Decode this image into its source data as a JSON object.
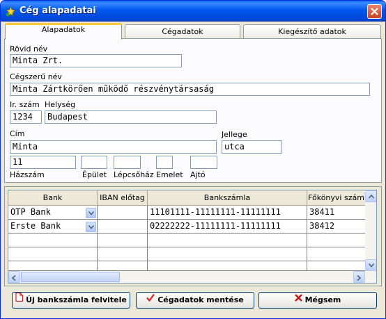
{
  "window": {
    "title": "Cég alapadatai"
  },
  "tabs": [
    {
      "label": "Alapadatok",
      "active": true
    },
    {
      "label": "Cégadatok",
      "active": false
    },
    {
      "label": "Kiegészítő adatok",
      "active": false
    }
  ],
  "form": {
    "short_name": {
      "label": "Rövid név",
      "value": "Minta Zrt."
    },
    "company_name": {
      "label": "Cégszerű név",
      "value": "Minta Zártkörően működő részvénytársaság"
    },
    "zip": {
      "label": "Ir. szám",
      "value": "1234"
    },
    "city": {
      "label": "Helység",
      "value": "Budapest"
    },
    "address": {
      "label": "Cím",
      "value": "Minta"
    },
    "street_type": {
      "label": "Jellege",
      "value": "utca"
    },
    "house_no": {
      "label": "Házszám",
      "value": "11"
    },
    "building": {
      "label": "Épület",
      "value": ""
    },
    "staircase": {
      "label": "Lépcsőház",
      "value": ""
    },
    "floor": {
      "label": "Emelet",
      "value": ""
    },
    "door": {
      "label": "Ajtó",
      "value": ""
    }
  },
  "grid": {
    "columns": [
      "Bank",
      "IBAN előtag",
      "Bankszámla",
      "Főkönyvi szám"
    ],
    "rows": [
      {
        "bank": "OTP Bank",
        "iban": "",
        "account": "11101111-11111111-11111111",
        "ledger": "38411"
      },
      {
        "bank": "Erste Bank",
        "iban": "",
        "account": "02222222-11111111-11111111",
        "ledger": "38412"
      }
    ]
  },
  "buttons": {
    "new_account": "Új bankszámla felvitele",
    "save": "Cégadatok mentése",
    "cancel": "Mégsem"
  },
  "colors": {
    "titlebar": "#0058ee",
    "active_tab_accent": "#ffc83c",
    "save_icon": "#d42020",
    "cancel_icon": "#c81414"
  }
}
